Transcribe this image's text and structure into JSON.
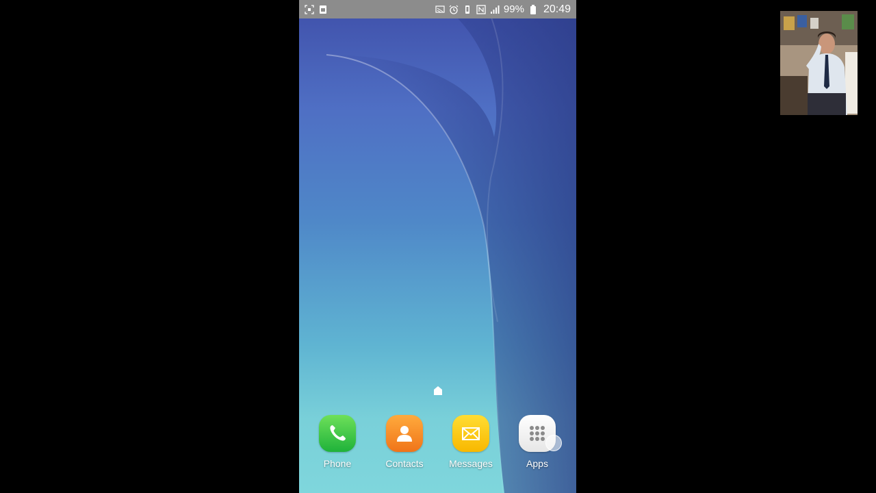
{
  "status_bar": {
    "left_icons": [
      "screenshot-icon",
      "storage-icon"
    ],
    "right_icons": [
      "cast-icon",
      "alarm-icon",
      "vibrate-icon",
      "nfc-icon",
      "signal-icon",
      "battery-icon"
    ],
    "battery_percent": "99%",
    "time": "20:49"
  },
  "dock": {
    "items": [
      {
        "label": "Phone",
        "icon": "phone-icon",
        "color": "#1fb23a"
      },
      {
        "label": "Contacts",
        "icon": "contact-icon",
        "color": "#f07419"
      },
      {
        "label": "Messages",
        "icon": "envelope-icon",
        "color": "#f8b800"
      },
      {
        "label": "Apps",
        "icon": "grid-icon",
        "color": "#e6e6e6"
      }
    ]
  },
  "home_indicator": {
    "icon": "home-icon"
  },
  "webcam_overlay": {
    "icon": "webcam-feed-image"
  }
}
